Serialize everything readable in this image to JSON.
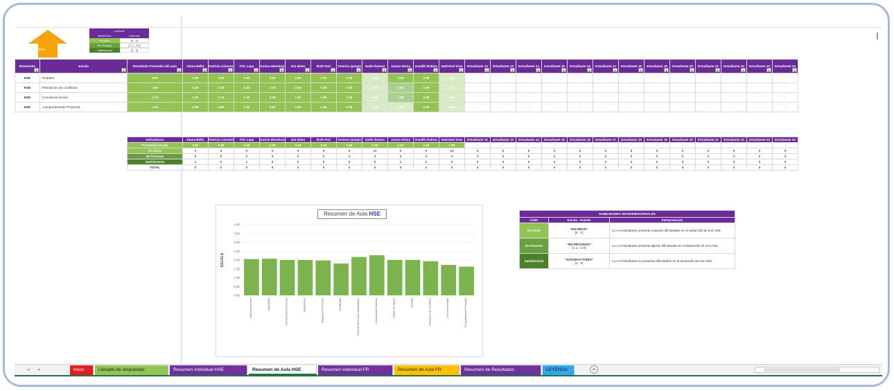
{
  "home_button": {
    "label": "Inicio"
  },
  "mini_legend": {
    "title": "Leyenda",
    "header": [
      "Nivel/Color",
      "Intervalo"
    ],
    "rows": [
      {
        "label": "En Inicio",
        "range": "[0 - 1]",
        "color": "#92c353"
      },
      {
        "label": "En Proceso",
        "range": "[1.1 - 2.0]",
        "color": "#6aa042"
      },
      {
        "label": "Satisfactorio",
        "range": "[3 - 4]",
        "color": "#4d7f2c"
      }
    ]
  },
  "main_table": {
    "col_dim": "Dimensión",
    "col_escala": "Escala",
    "col_result": "Resultado Promedio del aula",
    "students": [
      "Diana Bello",
      "Patricia Cáceres",
      "Flor Lapa",
      "Karina Mendoza",
      "Isla Nieto",
      "Ruth Puri",
      "Yesenia Quispe",
      "Sadie Ramos",
      "Amara Reina",
      "Gandhi Rubios",
      "Nativitad Soto",
      "Estudiante 12",
      "Estudiante 13",
      "Estudiante 14",
      "Estudiante 15",
      "Estudiante 16",
      "Estudiante 17",
      "Estudiante 18",
      "Estudiante 19",
      "Estudiante 20",
      "Estudiante 21",
      "Estudiante 22",
      "Estudiante 23",
      "Estudiante 24"
    ],
    "rows": [
      {
        "dim": "HSE",
        "escala": "Empatía",
        "prom": "2.60",
        "vals": [
          "2.60",
          "2.60",
          "2.50",
          "2.50",
          "2.50",
          "2.50",
          "2.40",
          "1.60",
          "2.00",
          "2.00",
          "1.60",
          "-",
          "-",
          "-",
          "-",
          "-",
          "-",
          "-",
          "-",
          "-",
          "-",
          "-",
          "-",
          "-"
        ]
      },
      {
        "dim": "HSE",
        "escala": "Resolución de Conflictos",
        "prom": "1.80",
        "vals": [
          "2.30",
          "2.30",
          "2.30",
          "2.00",
          "2.00",
          "2.00",
          "2.00",
          "1.50",
          "1.50",
          "2.00",
          "1.50",
          "-",
          "-",
          "-",
          "-",
          "-",
          "-",
          "-",
          "-",
          "-",
          "-",
          "-",
          "-",
          "-"
        ]
      },
      {
        "dim": "HSE",
        "escala": "Conciencia Social",
        "prom": "1.72",
        "vals": [
          "2.30",
          "2.30",
          "2.30",
          "2.00",
          "1.90",
          "1.90",
          "2.00",
          "1.30",
          "1.50",
          "2.00",
          "1.60",
          "-",
          "-",
          "-",
          "-",
          "-",
          "-",
          "-",
          "-",
          "-",
          "-",
          "-",
          "-",
          "-"
        ]
      },
      {
        "dim": "HSE",
        "escala": "Comportamiento Prosocial",
        "prom": "1.60",
        "vals": [
          "2.60",
          "2.60",
          "2.50",
          "2.50",
          "1.50",
          "1.50",
          "2.00",
          "1.50",
          "1.50",
          "2.00",
          "1.00",
          "-",
          "-",
          "-",
          "-",
          "-",
          "-",
          "-",
          "-",
          "-",
          "-",
          "-",
          "-",
          "-"
        ]
      }
    ],
    "shades": [
      [
        "g1",
        "g1",
        "g1",
        "g1",
        "g1",
        "g1",
        "g1",
        "g4",
        "g1",
        "g1",
        "g4"
      ],
      [
        "g1",
        "g1",
        "g1",
        "g1",
        "g1",
        "g1",
        "g1",
        "g4",
        "g3",
        "g1",
        "g4"
      ],
      [
        "g1",
        "g1",
        "g1",
        "g1",
        "g1",
        "g1",
        "g1",
        "g4",
        "g3",
        "g1",
        "g4"
      ],
      [
        "g1",
        "g1",
        "g1",
        "g1",
        "g1",
        "g1",
        "g1",
        "g4",
        "g4",
        "g1",
        "g4"
      ]
    ]
  },
  "indicators": {
    "header": "Indicadores",
    "rows": [
      {
        "label": "Promedio Escala",
        "cls": "g1",
        "vals": [
          "2.37",
          "2.26",
          "2.46",
          "2.25",
          "1.64",
          "1.64",
          "1.93",
          "1.35",
          "1.61",
          "2.16",
          "1.50",
          "-",
          "-",
          "-",
          "-",
          "-",
          "-",
          "-",
          "-",
          "-",
          "-",
          "-",
          "-",
          "-"
        ]
      },
      {
        "label": "En Inicio",
        "cls": "lvl1",
        "vals": [
          "0",
          "0",
          "0",
          "0",
          "0",
          "0",
          "0",
          "10",
          "2",
          "0",
          "10",
          "0",
          "0",
          "0",
          "0",
          "0",
          "0",
          "0",
          "0",
          "0",
          "0",
          "0",
          "0",
          "0"
        ]
      },
      {
        "label": "En Proceso",
        "cls": "lvl2",
        "vals": [
          "0",
          "0",
          "0",
          "0",
          "0",
          "0",
          "0",
          "0",
          "0",
          "0",
          "0",
          "0",
          "0",
          "0",
          "0",
          "0",
          "0",
          "0",
          "0",
          "0",
          "0",
          "0",
          "0",
          "0"
        ]
      },
      {
        "label": "Satisfactorio",
        "cls": "lvl3",
        "vals": [
          "1",
          "0",
          "1",
          "0",
          "0",
          "0",
          "0",
          "0",
          "1",
          "0",
          "0",
          "0",
          "0",
          "0",
          "0",
          "0",
          "0",
          "0",
          "0",
          "0",
          "0",
          "0",
          "0",
          "0"
        ]
      },
      {
        "label": "TOTAL",
        "cls": "tot",
        "vals": [
          "0",
          "0",
          "0",
          "0",
          "0",
          "0",
          "0",
          "0",
          "0",
          "0",
          "0",
          "0",
          "0",
          "0",
          "0",
          "0",
          "0",
          "0",
          "0",
          "0",
          "0",
          "0",
          "0",
          "0"
        ]
      }
    ]
  },
  "chart_data": {
    "type": "bar",
    "title_prefix": "Resumen de Aula",
    "title_tag": "HSE",
    "ylabel": "ESCALA",
    "ylim": [
      0,
      4
    ],
    "yticks": [
      "4.00",
      "3.50",
      "3.00",
      "2.50",
      "2.00",
      "1.50",
      "1.00",
      "0.50",
      "0.00"
    ],
    "categories": [
      "Autoconocimiento",
      "Autoestima",
      "Comprensión Emocional",
      "Autoeficacia",
      "Regulación Emocional",
      "Creatividad",
      "Toma de decisiones responsables",
      "Comunicación Asertiva",
      "Trabajo en equipo",
      "Empatía",
      "Resolución de Conflictos",
      "Conciencia Social",
      "Comportamiento Prosocial"
    ],
    "values": [
      2.05,
      2.07,
      2.0,
      2.0,
      1.97,
      1.8,
      2.17,
      2.27,
      2.0,
      2.0,
      1.93,
      1.72,
      1.62
    ],
    "bar_color": "#7db34f"
  },
  "habilidades": {
    "title": "HABILIDADES SOCIOEMOCIONALES",
    "header": [
      "Color",
      "Escala - Estado",
      "Interpretación"
    ],
    "rows": [
      {
        "color_label": "En Inicio",
        "color": "#92c353",
        "estado": "\"EN INICIO\"",
        "rango": "[0 - 1]",
        "interp": "Lo o el estudiante presenta mayores dificultades en el desarrollo de sus HSE."
      },
      {
        "color_label": "En Proceso",
        "color": "#6aa042",
        "estado": "\"EN PROCESO\"",
        "rango": "[1.1 - 2.0]",
        "interp": "Lo o el estudiante presenta ligeras dificultades en el desarrollo de sus HSE."
      },
      {
        "color_label": "Satisfactorio",
        "color": "#4d7f2c",
        "estado": "\"SATISFACTORIO\"",
        "rango": "[3 - 4]",
        "interp": "Lo o el estudiante no presenta dificultades en el desarrollo de sus HSE."
      }
    ]
  },
  "tabs": [
    {
      "label": "Inicio",
      "bg": "#e02020",
      "fg": "#ffffff"
    },
    {
      "label": "Llenado de respuestas",
      "bg": "#92c353",
      "fg": "#1a1a1a"
    },
    {
      "label": "Resumen Individual HSE",
      "bg": "#7030a0",
      "fg": "#ffffff"
    },
    {
      "label": "Resumen de Aula HSE",
      "bg": "#ffffff",
      "fg": "#1a1a1a",
      "active": true
    },
    {
      "label": "Resumen Individual FR",
      "bg": "#7030a0",
      "fg": "#ffffff"
    },
    {
      "label": "Resumen de Aula FR",
      "bg": "#ffc000",
      "fg": "#1a1a1a"
    },
    {
      "label": "Resumen de Resultados",
      "bg": "#7030a0",
      "fg": "#ffffff"
    },
    {
      "label": "LEYENDA",
      "bg": "#2ea8e6",
      "fg": "#1a1a1a"
    }
  ],
  "add_sheet": "+"
}
